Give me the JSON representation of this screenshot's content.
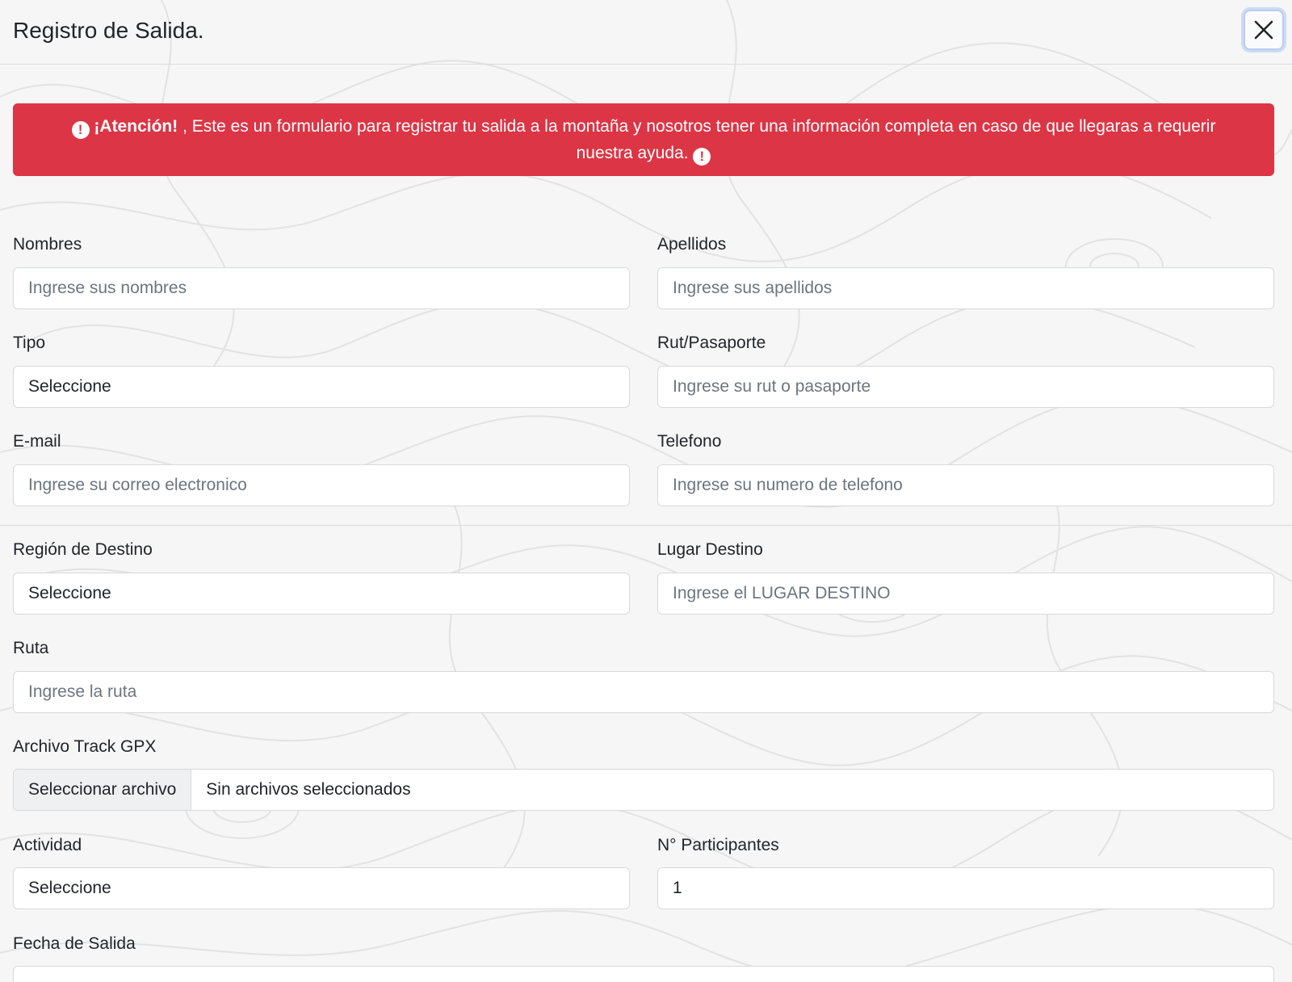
{
  "modal": {
    "title": "Registro de Salida."
  },
  "alert": {
    "strong": "¡Atención!",
    "message": ", Este es un formulario para registrar tu salida a la montaña y nosotros tener una información completa en caso de que llegaras a requerir nuestra ayuda.",
    "icon": "exclamation-circle-icon"
  },
  "form": {
    "nombres": {
      "label": "Nombres",
      "placeholder": "Ingrese sus nombres"
    },
    "apellidos": {
      "label": "Apellidos",
      "placeholder": "Ingrese sus apellidos"
    },
    "tipo": {
      "label": "Tipo",
      "value": "Seleccione"
    },
    "rut": {
      "label": "Rut/Pasaporte",
      "placeholder": "Ingrese su rut o pasaporte"
    },
    "email": {
      "label": "E-mail",
      "placeholder": "Ingrese su correo electronico"
    },
    "telefono": {
      "label": "Telefono",
      "placeholder": "Ingrese su numero de telefono"
    },
    "region": {
      "label": "Región de Destino",
      "value": "Seleccione"
    },
    "lugar": {
      "label": "Lugar Destino",
      "placeholder": "Ingrese el LUGAR DESTINO"
    },
    "ruta": {
      "label": "Ruta",
      "placeholder": "Ingrese la ruta"
    },
    "archivo": {
      "label": "Archivo Track GPX",
      "button": "Seleccionar archivo",
      "status": "Sin archivos seleccionados"
    },
    "actividad": {
      "label": "Actividad",
      "value": "Seleccione"
    },
    "participantes": {
      "label": "N° Participantes",
      "value": "1"
    },
    "fecha": {
      "label": "Fecha de Salida"
    }
  },
  "colors": {
    "alert": "#dc3545",
    "background": "#f6f6f6",
    "border": "#d6d9dc"
  }
}
